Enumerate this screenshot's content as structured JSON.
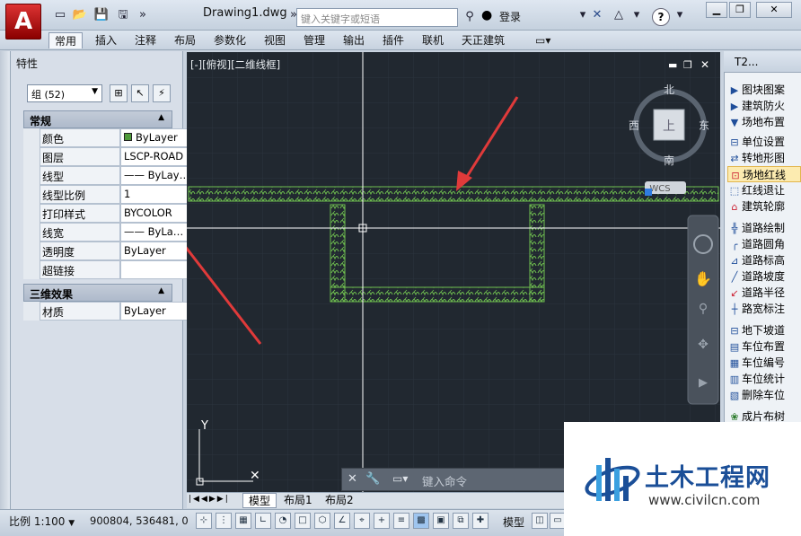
{
  "title_bar": {
    "doc_title": "Drawing1.dwg",
    "search_placeholder": "键入关键字或短语",
    "login": "登录",
    "help": "?"
  },
  "ribbon_tabs": [
    "常用",
    "插入",
    "注释",
    "布局",
    "参数化",
    "视图",
    "管理",
    "输出",
    "插件",
    "联机",
    "天正建筑"
  ],
  "properties_palette": {
    "title": "特性",
    "selection": "组 (52)",
    "sections": [
      {
        "title": "常规",
        "rows": [
          {
            "name": "颜色",
            "value": "ByLayer"
          },
          {
            "name": "图层",
            "value": "LSCP-ROAD"
          },
          {
            "name": "线型",
            "value": "—— ByLay…"
          },
          {
            "name": "线型比例",
            "value": "1"
          },
          {
            "name": "打印样式",
            "value": "BYCOLOR"
          },
          {
            "name": "线宽",
            "value": "—— ByLa…"
          },
          {
            "name": "透明度",
            "value": "ByLayer"
          },
          {
            "name": "超链接",
            "value": ""
          }
        ]
      },
      {
        "title": "三维效果",
        "rows": [
          {
            "name": "材质",
            "value": "ByLayer"
          }
        ]
      }
    ]
  },
  "canvas": {
    "view_label": "[-][俯视][二维线框]",
    "viewcube": {
      "north": "北",
      "south": "南",
      "east": "东",
      "west": "西",
      "face": "上",
      "wcs": "WCS"
    },
    "colors": {
      "background": "#212830",
      "hatch": "#6fbf4f",
      "arrow": "#e03a3a",
      "crosshair": "#ffffff"
    }
  },
  "tool_palette": {
    "title": "T2...",
    "items": [
      "图块图案",
      "建筑防火",
      "场地布置",
      "单位设置",
      "转地形图",
      "场地红线",
      "红线退让",
      "建筑轮廓",
      "道路绘制",
      "道路圆角",
      "道路标高",
      "道路坡度",
      "道路半径",
      "路宽标注",
      "地下坡道",
      "车位布置",
      "车位编号",
      "车位统计",
      "删除车位",
      "成片布树"
    ]
  },
  "command_line": {
    "placeholder": "键入命令"
  },
  "layout_tabs": [
    "模型",
    "布局1",
    "布局2"
  ],
  "status_bar": {
    "scale": "比例 1:100",
    "coords": "900804, 536481, 0",
    "model": "模型"
  },
  "watermark": {
    "name": "土木工程网",
    "url": "www.civilcn.com"
  }
}
